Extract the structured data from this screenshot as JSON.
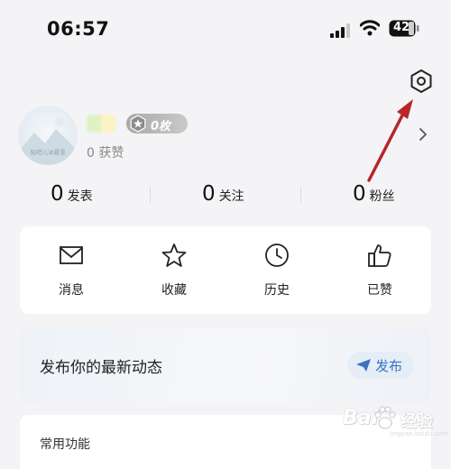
{
  "status_bar": {
    "time": "06:57",
    "battery_level": "42",
    "icons": [
      "cellular-signal-icon",
      "wifi-icon",
      "battery-icon"
    ]
  },
  "header": {
    "settings_icon": "hexagon-gear-icon"
  },
  "profile": {
    "avatar_caption": "贴吧儿冰暴雪",
    "medal_count": "0枚",
    "likes": "0 获赞",
    "chevron_icon": "chevron-right-icon"
  },
  "stats": [
    {
      "value": "0",
      "label": "发表"
    },
    {
      "value": "0",
      "label": "关注"
    },
    {
      "value": "0",
      "label": "粉丝"
    }
  ],
  "actions": [
    {
      "label": "消息",
      "icon": "envelope-icon"
    },
    {
      "label": "收藏",
      "icon": "star-icon"
    },
    {
      "label": "历史",
      "icon": "clock-icon"
    },
    {
      "label": "已赞",
      "icon": "thumbs-up-icon"
    }
  ],
  "post_card": {
    "title": "发布你的最新动态",
    "button_label": "发布",
    "button_icon": "paper-plane-icon"
  },
  "common_functions": {
    "title": "常用功能"
  },
  "watermark": {
    "brand": "Bai",
    "suffix": "经验",
    "url": "jingyan.baidu.com"
  },
  "colors": {
    "background": "#f4f4f6",
    "card": "#ffffff",
    "accent_blue": "#3a71c1",
    "arrow_red": "#b8262a"
  }
}
